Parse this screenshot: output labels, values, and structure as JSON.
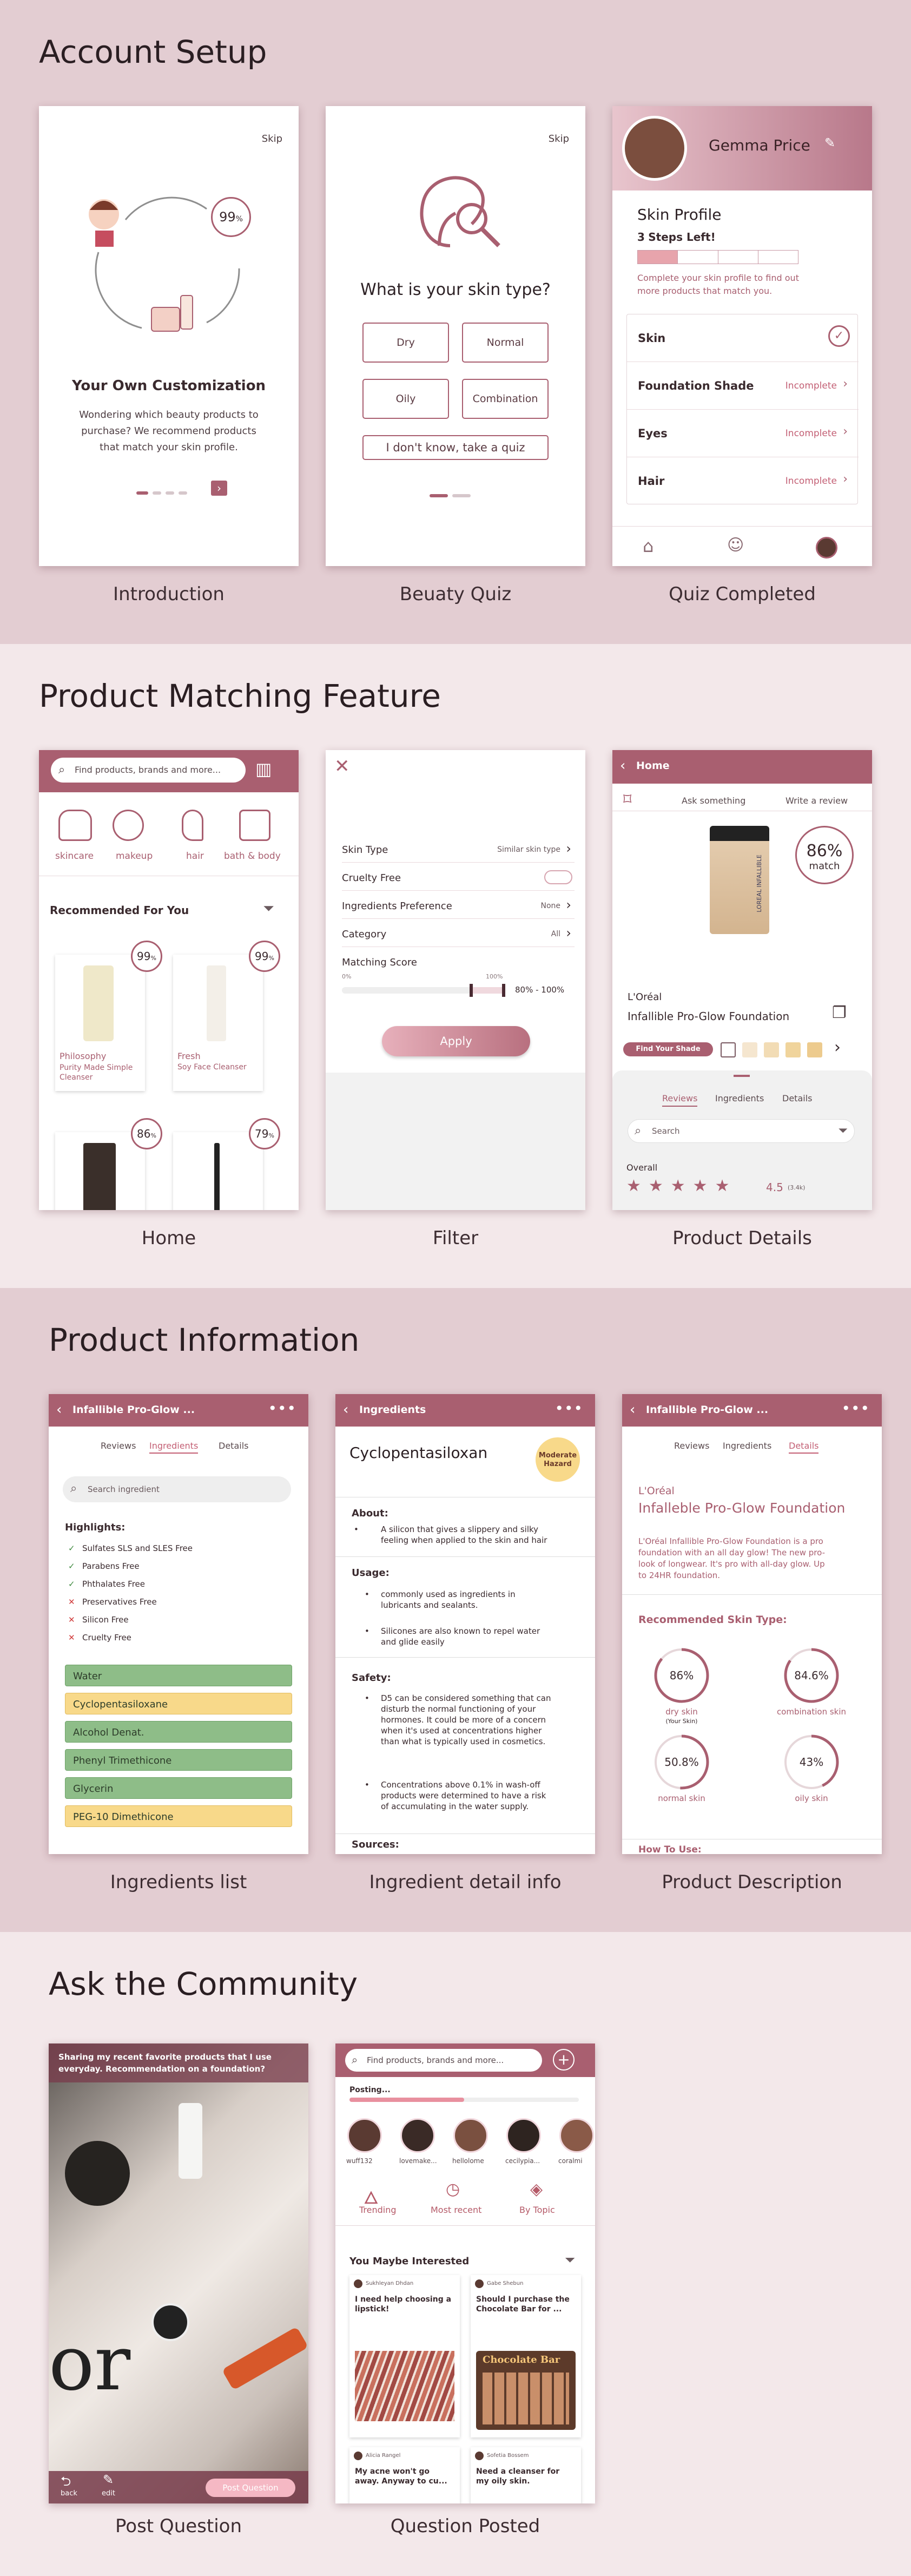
{
  "sections": {
    "account": {
      "title": "Account Setup",
      "captions": [
        "Introduction",
        "Beuaty Quiz",
        "Quiz Completed"
      ]
    },
    "matching": {
      "title": "Product Matching Feature",
      "captions": [
        "Home",
        "Filter",
        "Product Details"
      ]
    },
    "info": {
      "title": "Product Information",
      "captions": [
        "Ingredients list",
        "Ingredient detail info",
        "Product Description"
      ]
    },
    "community": {
      "title": "Ask the Community",
      "captions": [
        "Post Question",
        "Question Posted"
      ]
    }
  },
  "intro": {
    "skip": "Skip",
    "match": "99",
    "pct": "%",
    "title": "Your Own Customization",
    "desc": [
      "Wondering which beauty products to",
      "purchase? We recommend products",
      "that match your skin profile."
    ]
  },
  "quiz": {
    "skip": "Skip",
    "question": "What is your skin type?",
    "options": [
      "Dry",
      "Normal",
      "Oily",
      "Combination"
    ],
    "quiz_link": "I don't know, take a quiz"
  },
  "completed": {
    "name": "Gemma Price",
    "profile_title": "Skin Profile",
    "steps_num": "3",
    "steps_text": "Steps Left!",
    "desc": [
      "Complete your skin profile to find out",
      "more products that match you."
    ],
    "rows": [
      {
        "label": "Skin",
        "status": ""
      },
      {
        "label": "Foundation Shade",
        "status": "Incomplete"
      },
      {
        "label": "Eyes",
        "status": "Incomplete"
      },
      {
        "label": "Hair",
        "status": "Incomplete"
      }
    ]
  },
  "home": {
    "search_placeholder": "Find products, brands and more...",
    "categories": [
      "skincare",
      "makeup",
      "hair",
      "bath & body"
    ],
    "recommended": "Recommended For You",
    "products": [
      {
        "brand": "Philosophy",
        "name": [
          "Purity Made Simple",
          "Cleanser"
        ],
        "match": "99"
      },
      {
        "brand": "Fresh",
        "name": [
          "Soy Face Cleanser"
        ],
        "match": "99"
      },
      {
        "brand": "",
        "name": [],
        "match": "86"
      },
      {
        "brand": "",
        "name": [],
        "match": "79"
      }
    ]
  },
  "filter": {
    "rows": [
      {
        "label": "Skin Type",
        "value": "Similar skin type"
      },
      {
        "label": "Cruelty Free",
        "value": ""
      },
      {
        "label": "Ingredients Preference",
        "value": "None"
      },
      {
        "label": "Category",
        "value": "All"
      }
    ],
    "score_label": "Matching Score",
    "min": "0%",
    "max": "100%",
    "range": "80% - 100%",
    "apply": "Apply"
  },
  "details": {
    "header": "Home",
    "ask": "Ask something",
    "review": "Write a review",
    "match": "86%",
    "match_word": "match",
    "product_label": "LOREAL INFALLIBLE",
    "brand": "L'Oréal",
    "name": "Infallible Pro-Glow Foundation",
    "shade_btn": "Find Your Shade",
    "tabs": [
      "Reviews",
      "Ingredients",
      "Details"
    ],
    "search": "Search",
    "overall": "Overall",
    "rating": "4.5",
    "rating_count": "(3.4k)",
    "stars": 4.5
  },
  "ingredients": {
    "header": "Infallible Pro-Glow ...",
    "tabs": [
      "Reviews",
      "Ingredients",
      "Details"
    ],
    "search": "Search ingredient",
    "highlights": "Highlights:",
    "items": [
      {
        "text": "Sulfates SLS and SLES Free",
        "ok": true
      },
      {
        "text": "Parabens Free",
        "ok": true
      },
      {
        "text": "Phthalates Free",
        "ok": true
      },
      {
        "text": "Preservatives Free",
        "ok": false
      },
      {
        "text": "Silicon Free",
        "ok": false
      },
      {
        "text": "Cruelty Free",
        "ok": false
      }
    ],
    "list": [
      {
        "name": "Water",
        "level": "green"
      },
      {
        "name": "Cyclopentasiloxane",
        "level": "yellow"
      },
      {
        "name": "Alcohol Denat.",
        "level": "green"
      },
      {
        "name": "Phenyl Trimethicone",
        "level": "green"
      },
      {
        "name": "Glycerin",
        "level": "green"
      },
      {
        "name": "PEG-10 Dimethicone",
        "level": "yellow"
      }
    ]
  },
  "ingdetail": {
    "header": "Ingredients",
    "name": "Cyclopentasiloxan",
    "badge": [
      "Moderate",
      "Hazard"
    ],
    "about_h": "About:",
    "about": [
      "A silicon that gives a slippery and silky",
      "feeling when applied to the skin and hair"
    ],
    "usage_h": "Usage:",
    "usage": [
      [
        "commonly used as ingredients in",
        "lubricants and sealants."
      ],
      [
        "Silicones are also known to repel water",
        "and glide easily"
      ]
    ],
    "safety_h": "Safety:",
    "safety": [
      [
        "D5 can be considered something that can",
        "disturb the normal functioning of your",
        "hormones. It could be more of a concern",
        "when it's used at concentrations higher",
        "than what is typically used in cosmetics."
      ],
      [
        "Concentrations above 0.1% in wash-off",
        "products were determined to have a risk",
        "of accumulating in the water supply."
      ]
    ],
    "sources_h": "Sources:"
  },
  "description": {
    "header": "Infallible Pro-Glow ...",
    "tabs": [
      "Reviews",
      "Ingredients",
      "Details"
    ],
    "brand": "L'Oréal",
    "name": "Infalleble Pro-Glow Foundation",
    "desc": [
      "L'Oréal Infallible Pro-Glow Foundation is a pro",
      "foundation with an all day glow! The new pro-",
      "look of longwear. It's pro with all-day glow. Up",
      "to 24HR foundation."
    ],
    "rec_h": "Recommended Skin Type:",
    "types": [
      {
        "label": "dry skin",
        "sub": "(Your Skin)",
        "value": "86",
        "fill": 0.86
      },
      {
        "label": "combination skin",
        "sub": "",
        "value": "84.6",
        "fill": 0.846
      },
      {
        "label": "normal skin",
        "sub": "",
        "value": "50.8",
        "fill": 0.508
      },
      {
        "label": "oily skin",
        "sub": "",
        "value": "43",
        "fill": 0.43
      }
    ],
    "howto": "How To Use:"
  },
  "post": {
    "text": [
      "Sharing my recent favorite products that I use",
      "everyday. Recommendation on a foundation?"
    ],
    "back": "back",
    "edit": "edit",
    "btn": "Post Question"
  },
  "posted": {
    "search": "Find products, brands and more...",
    "posting": "Posting...",
    "progress": 0.5,
    "users": [
      "wuff132",
      "lovemake...",
      "hellolome",
      "cecilypia...",
      "coralmi"
    ],
    "filters": [
      "Trending",
      "Most recent",
      "By Topic"
    ],
    "interest": "You Maybe Interested",
    "cards": [
      {
        "user": "Sukhleyan Dhdan",
        "text": [
          "I need help choosing a",
          "lipstick!"
        ]
      },
      {
        "user": "Gabe Shebun",
        "text": [
          "Should I purchase the",
          "Chocolate Bar for ..."
        ]
      },
      {
        "user": "Alicia Rangel",
        "text": [
          "My acne won't go",
          "away. Anyway to cu..."
        ]
      },
      {
        "user": "Sofetia Bossem",
        "text": [
          "Need a cleanser for",
          "my oily skin."
        ]
      }
    ],
    "palette_label": "Chocolate Bar"
  },
  "colors": {
    "accent": "#a95f70",
    "band1": "#e3cdd2",
    "band2": "#f3e8ea",
    "green": "#8ebd88",
    "yellow": "#f8d98a"
  }
}
